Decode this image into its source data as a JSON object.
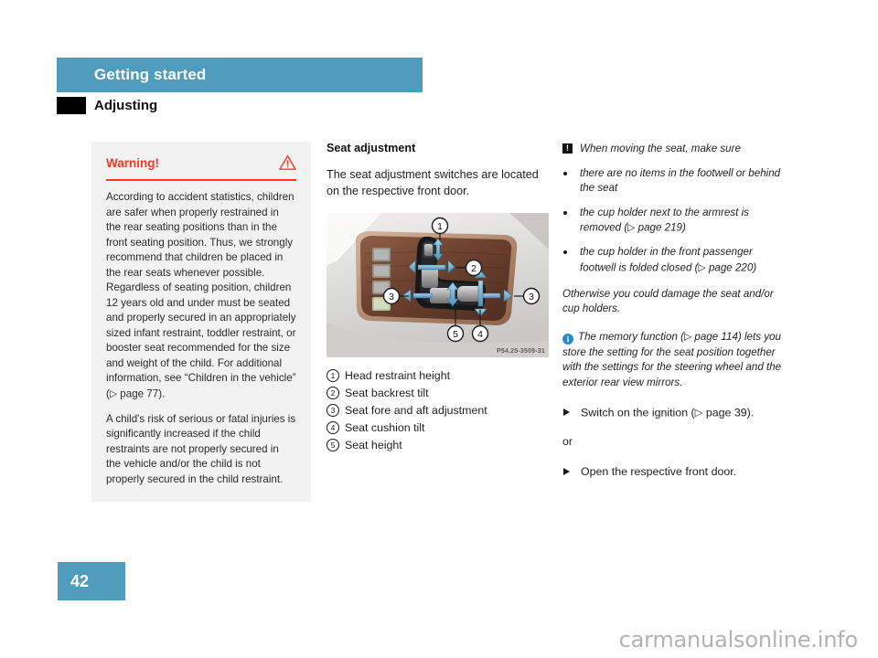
{
  "header": {
    "band_title": "Getting started",
    "section_title": "Adjusting"
  },
  "warning": {
    "title": "Warning!",
    "icon": "warning-triangle-icon",
    "accent_color": "#f93822",
    "background": "#f2f2f2",
    "paragraphs": [
      "According to accident statistics, children are safer when properly restrained in the rear seating positions than in the front seating position. Thus, we strongly recommend that children be placed in the rear seats whenever possible. Regardless of seating position, children 12 years old and under must be seated and properly secured in an appropriately sized infant restraint, toddler restraint, or booster seat recommended for the size and weight of the child. For additional information, see “Children in the vehicle” (▷ page 77).",
      "A child's risk of serious or fatal injuries is significantly increased if the child restraints are not properly secured in the vehicle and/or the child is not properly secured in the child restraint."
    ]
  },
  "middle": {
    "heading": "Seat adjustment",
    "intro": "The seat adjustment switches are located on the respective front door.",
    "figure_code": "P54.25-3509-31",
    "figure_callouts": [
      "1",
      "2",
      "3",
      "3",
      "4",
      "5"
    ],
    "legend": [
      {
        "num": "1",
        "label": "Head restraint height"
      },
      {
        "num": "2",
        "label": "Seat backrest tilt"
      },
      {
        "num": "3",
        "label": "Seat fore and aft adjustment"
      },
      {
        "num": "4",
        "label": "Seat cushion tilt"
      },
      {
        "num": "5",
        "label": "Seat height"
      }
    ]
  },
  "right": {
    "caution_icon": "exclamation-box-icon",
    "caution_lead": "When moving the seat, make sure",
    "caution_bullets": [
      "there are no items in the footwell or behind the seat",
      "the cup holder next to the armrest is removed (▷ page 219)",
      "the cup holder in the front passenger footwell is folded closed (▷ page 220)"
    ],
    "caution_tail": "Otherwise you could damage the seat and/or cup holders.",
    "info_icon": "info-circle-icon",
    "info_icon_color": "#2b8ac6",
    "info_text": "The memory function (▷ page 114) lets you store the setting for the seat position together with the settings for the steering wheel and the exterior rear view mirrors.",
    "step_1": "Switch on the ignition (▷ page 39).",
    "or_label": "or",
    "step_2": "Open the respective front door."
  },
  "footer": {
    "page_number": "42",
    "watermark": "carmanualsonline.info",
    "badge_color": "#4f9cbc"
  }
}
